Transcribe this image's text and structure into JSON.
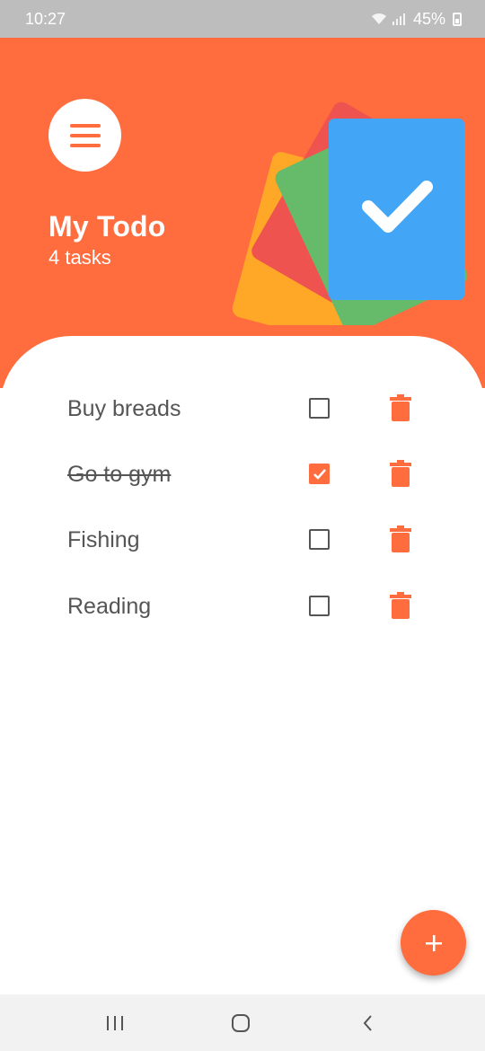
{
  "status_bar": {
    "time": "10:27",
    "battery": "45%",
    "icons": [
      "wifi-icon",
      "signal-icon",
      "battery-icon"
    ]
  },
  "header": {
    "title": "My Todo",
    "subtitle": "4 tasks",
    "background_color": "#ff6c3e",
    "illustration_card_colors": [
      "#ffa726",
      "#ef5350",
      "#66bb6a",
      "#42a5f5"
    ]
  },
  "tasks": [
    {
      "label": "Buy breads",
      "done": false
    },
    {
      "label": "Go to gym",
      "done": true
    },
    {
      "label": "Fishing",
      "done": false
    },
    {
      "label": "Reading",
      "done": false
    }
  ],
  "fab": {
    "icon": "plus-icon"
  },
  "nav_bar": {
    "icons": [
      "recent-apps-icon",
      "home-icon",
      "back-icon"
    ]
  }
}
